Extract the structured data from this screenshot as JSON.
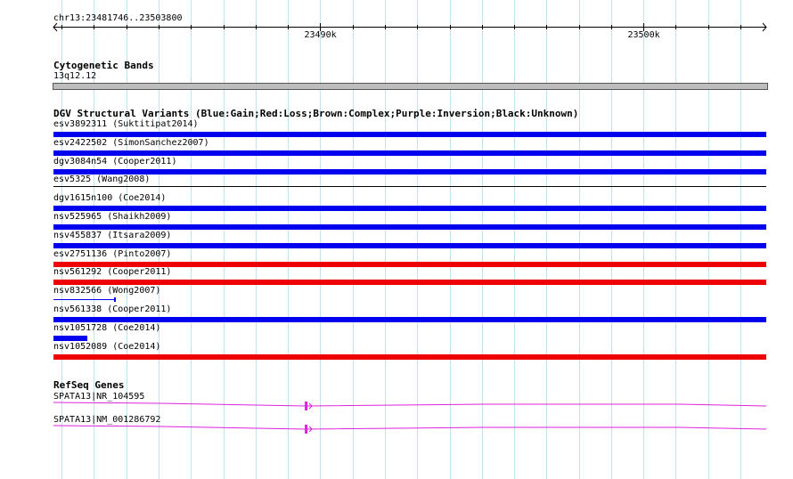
{
  "ruler": {
    "region": "chr13:23481746..23503800",
    "ticks": [
      {
        "label": "23490k",
        "pos": 23490000
      },
      {
        "label": "23500k",
        "pos": 23500000
      }
    ]
  },
  "cyto": {
    "title": "Cytogenetic Bands",
    "band": "13q12.12"
  },
  "dgv": {
    "title": "DGV Structural Variants (Blue:Gain;Red:Loss;Brown:Complex;Purple:Inversion;Black:Unknown)",
    "colors": {
      "gain": "#0000ee",
      "loss": "#ee0000",
      "unknown": "#000000"
    },
    "items": [
      {
        "label": "esv3892311 (Suktitipat2014)",
        "type": "gain",
        "start": 23481746,
        "end": 23503800
      },
      {
        "label": "esv2422502 (SimonSanchez2007)",
        "type": "gain",
        "start": 23481746,
        "end": 23503800
      },
      {
        "label": "dgv3084n54 (Cooper2011)",
        "type": "gain",
        "start": 23481746,
        "end": 23503800
      },
      {
        "label": "esv5325 (Wang2008)",
        "type": "unknown",
        "start": 23481746,
        "end": 23503800
      },
      {
        "label": "dgv1615n100 (Coe2014)",
        "type": "gain",
        "start": 23481746,
        "end": 23503800
      },
      {
        "label": "nsv525965 (Shaikh2009)",
        "type": "gain",
        "start": 23481746,
        "end": 23503800
      },
      {
        "label": "nsv455837 (Itsara2009)",
        "type": "gain",
        "start": 23481746,
        "end": 23503800
      },
      {
        "label": "esv2751136 (Pinto2007)",
        "type": "loss",
        "start": 23481746,
        "end": 23503800
      },
      {
        "label": "nsv561292 (Cooper2011)",
        "type": "loss",
        "start": 23481746,
        "end": 23503800
      },
      {
        "label": "nsv832566 (Wong2007)",
        "type": "gain",
        "start": 23481746,
        "end": 23483660,
        "thin": true
      },
      {
        "label": "nsv561338 (Cooper2011)",
        "type": "gain",
        "start": 23481746,
        "end": 23503800
      },
      {
        "label": "nsv1051728 (Coe2014)",
        "type": "gain",
        "start": 23481746,
        "end": 23482780
      },
      {
        "label": "nsv1052089 (Coe2014)",
        "type": "loss",
        "start": 23481746,
        "end": 23503800
      }
    ]
  },
  "refseq": {
    "title": "RefSeq Genes",
    "color": "#dd22dd",
    "genes": [
      {
        "label": "SPATA13|NR_104595",
        "exon": 23489550
      },
      {
        "label": "SPATA13|NM_001286792",
        "exon": 23489550
      }
    ]
  }
}
